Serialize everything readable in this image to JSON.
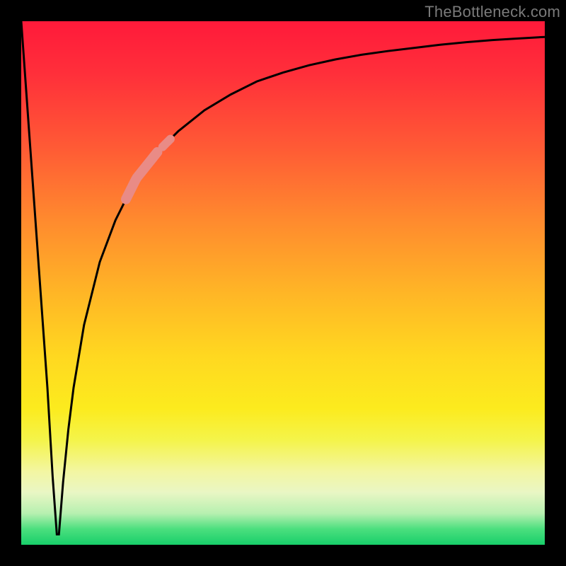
{
  "watermark": "TheBottleneck.com",
  "colors": {
    "curve": "#000000",
    "highlight": "#e98b86",
    "gradient_top": "#ff1a3a",
    "gradient_bottom": "#18cf6a",
    "frame_background": "#000000",
    "watermark_text": "#7a7a7a"
  },
  "chart_data": {
    "type": "line",
    "title": "",
    "xlabel": "",
    "ylabel": "",
    "xlim": [
      0,
      100
    ],
    "ylim": [
      0,
      100
    ],
    "grid": false,
    "legend": false,
    "description": "Bottleneck percentage curve with sharp V-shaped notch near x≈7; minimum ≈0 bottleneck; curve rises asymptotically toward ~100 as x grows. Vertical gradient background encodes value (red=high bottleneck, green=low).",
    "series": [
      {
        "name": "bottleneck-curve",
        "x": [
          0,
          3,
          5,
          6,
          6.8,
          7.2,
          8,
          9,
          10,
          12,
          15,
          18,
          22,
          26,
          30,
          35,
          40,
          45,
          50,
          55,
          60,
          65,
          70,
          75,
          80,
          85,
          90,
          95,
          100
        ],
        "y": [
          100,
          58,
          30,
          13,
          2,
          2,
          12,
          22,
          30,
          42,
          54,
          62,
          70,
          75,
          79,
          83,
          86,
          88.5,
          90.2,
          91.6,
          92.7,
          93.6,
          94.3,
          94.9,
          95.5,
          96,
          96.4,
          96.7,
          97
        ]
      }
    ],
    "highlight_segments": [
      {
        "x_start": 20,
        "x_end": 26,
        "note": "thick pink highlighted portion of curve"
      },
      {
        "x_start": 27,
        "x_end": 28.5,
        "note": "small secondary pink dot on curve"
      }
    ]
  }
}
